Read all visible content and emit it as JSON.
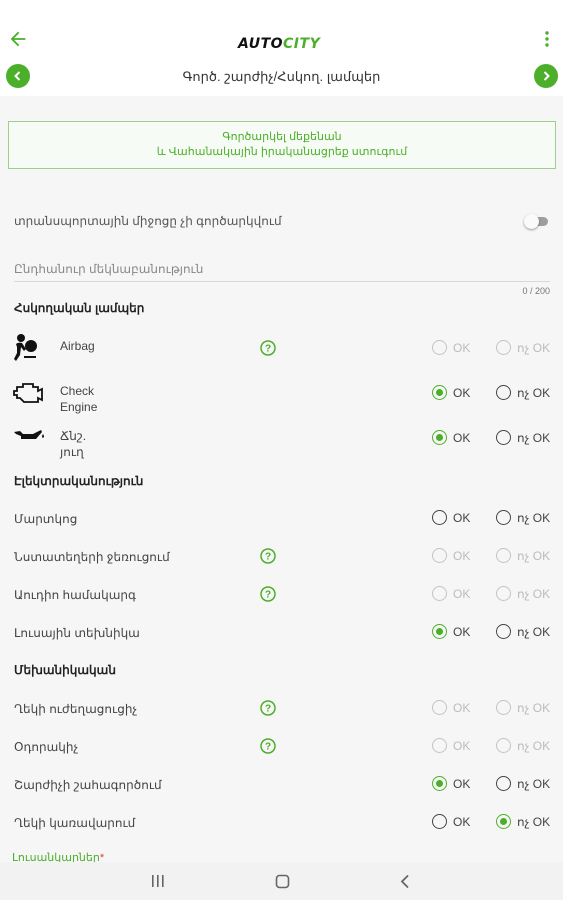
{
  "header": {
    "logo_auto": "AUTO",
    "logo_city": "CITY",
    "title": "Գործ. շարժիչ/Հսկող. լամպեր"
  },
  "notice": {
    "line1": "Գործարկել մեքենան",
    "line2": "և Վահանակային իրականացրեք ստուգում"
  },
  "toggle": {
    "label": "տրանսպորտային միջոցը չի գործարկվում",
    "on": false
  },
  "comment": {
    "placeholder": "Ընդհանուր մեկնաբանություն",
    "value": "",
    "counter": "0 / 200"
  },
  "options": {
    "ok": "OK",
    "not_ok": "ոչ OK"
  },
  "sections": {
    "warning_lamps": {
      "title": "Հսկողական լամպեր",
      "items": [
        {
          "label": "Airbag",
          "icon": "airbag-icon",
          "help": true,
          "state": "none",
          "disabled": true
        },
        {
          "label_line1": "Check",
          "label_line2": "Engine",
          "icon": "check-engine-icon",
          "help": false,
          "state": "ok",
          "disabled": false
        },
        {
          "label_line1": "Ճնշ.",
          "label_line2": "յուղ",
          "icon": "oil-pressure-icon",
          "help": false,
          "state": "ok",
          "disabled": false
        }
      ]
    },
    "electronics": {
      "title": "Էլեկտրականություն",
      "items": [
        {
          "label": "Մարտկոց",
          "help": false,
          "state": "none",
          "disabled": false
        },
        {
          "label": "Նստատեղերի ջեռուցում",
          "help": true,
          "state": "none",
          "disabled": true
        },
        {
          "label": "Աուդիո համակարգ",
          "help": true,
          "state": "none",
          "disabled": true
        },
        {
          "label": "Լուսային տեխնիկա",
          "help": false,
          "state": "ok",
          "disabled": false
        }
      ]
    },
    "mechanics": {
      "title": "Մեխանիկական",
      "items": [
        {
          "label": "Ղեկի ուժեղացուցիչ",
          "help": true,
          "state": "none",
          "disabled": true
        },
        {
          "label": "Օդորակիչ",
          "help": true,
          "state": "none",
          "disabled": true
        },
        {
          "label": "Շարժիչի շահագործում",
          "help": false,
          "state": "ok",
          "disabled": false
        },
        {
          "label": "Ղեկի կառավարում",
          "help": false,
          "state": "not_ok",
          "disabled": false
        }
      ]
    }
  },
  "photos": {
    "label": "Լուսանկարներ",
    "required_mark": "*"
  },
  "colors": {
    "accent": "#4caf2a",
    "required": "#e53935",
    "background": "#f6f6f6"
  }
}
